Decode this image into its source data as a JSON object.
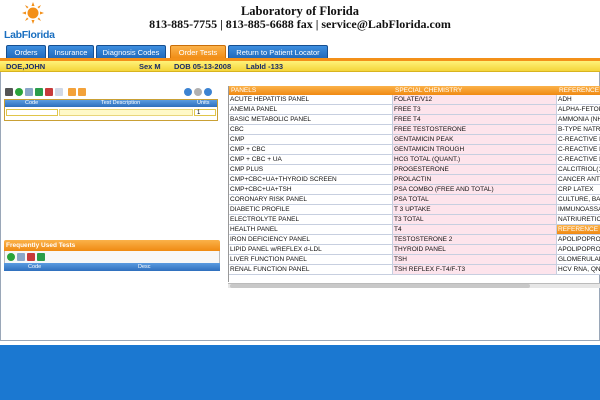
{
  "app": {
    "logo_lab": "Lab",
    "logo_florida": "Florida",
    "lab_name": "Laboratory of Florida",
    "contact": "813-885-7755 | 813-885-6688 fax | service@LabFlorida.com"
  },
  "tabs": [
    {
      "label": "Orders"
    },
    {
      "label": "Insurance"
    },
    {
      "label": "Diagnosis Codes"
    },
    {
      "label": "Order Tests"
    },
    {
      "label": "Return to Patient Locator"
    }
  ],
  "patient": {
    "name": "DOE,JOHN",
    "sex": "Sex M",
    "dob": "DOB 05-13-2008",
    "labid": "LabId -133"
  },
  "order_grid": {
    "col_code": "Code",
    "col_desc": "Test Description",
    "col_units": "Units",
    "units_value": "1"
  },
  "frequent": {
    "title": "Frequently Used Tests",
    "col_code": "Code",
    "col_desc": "Desc"
  },
  "tests": {
    "headers": [
      "PANELS",
      "SPECIAL CHEMISTRY",
      "REFERENCE"
    ],
    "rows": [
      [
        "ACUTE HEPATITIS PANEL",
        "FOLATE/V12",
        "ADH"
      ],
      [
        "ANEMIA PANEL",
        "FREE T3",
        "ALPHA-FETOP"
      ],
      [
        "BASIC METABOLIC PANEL",
        "FREE T4",
        "AMMONIA (NH"
      ],
      [
        "CBC",
        "FREE TESTOSTERONE",
        "B-TYPE NATRI"
      ],
      [
        "CMP",
        "GENTAMICIN PEAK",
        "C-REACTIVE P"
      ],
      [
        "CMP + CBC",
        "GENTAMICIN TROUGH",
        "C-REACTIVE P"
      ],
      [
        "CMP + CBC + UA",
        "HCG TOTAL (QUANT.)",
        "C-REACTIVE P"
      ],
      [
        "CMP PLUS",
        "PROGESTERONE",
        "CALCITRIOL(1"
      ],
      [
        "CMP+CBC+UA+THYROID SCREEN",
        "PROLACTIN",
        "CANCER ANTI"
      ],
      [
        "CMP+CBC+UA+TSH",
        "PSA COMBO (FREE AND TOTAL)",
        "CRP LATEX"
      ],
      [
        "CORONARY RISK PANEL",
        "PSA TOTAL",
        "CULTURE, BA"
      ],
      [
        "DIABETIC PROFILE",
        "T 3 UPTAKE",
        "IMMUNOASSAY"
      ],
      [
        "ELECTROLYTE PANEL",
        "T3 TOTAL",
        "NATRIURETIC"
      ],
      [
        "HEALTH PANEL",
        "T4",
        "REFERENCE"
      ],
      [
        "IRON DEFICIENCY PANEL",
        "TESTOSTERONE 2",
        "APOLIPOPRO"
      ],
      [
        "LIPID PANEL w/REFLEX d-LDL",
        "THYROID PANEL",
        "APOLIPOPRO"
      ],
      [
        "LIVER FUNCTION PANEL",
        "TSH",
        "GLOMERULAR"
      ],
      [
        "RENAL FUNCTION PANEL",
        "TSH REFLEX F-T4/F-T3",
        "HCV RNA, QN"
      ]
    ]
  }
}
